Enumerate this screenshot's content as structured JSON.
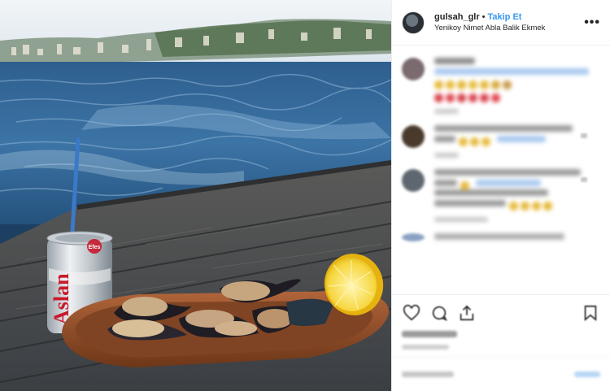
{
  "post": {
    "username": "gulsah_glr",
    "separator": "•",
    "follow_label": "Takip Et",
    "location": "Yenikoy Nimet Abla Balik Ekmek",
    "more_label": "•••"
  },
  "photo": {
    "can_brand": "Aslan",
    "can_badge": "Efes"
  },
  "colors": {
    "link_blue": "#3897f0",
    "border": "#efefef"
  },
  "icons": {
    "like": "heart-icon",
    "comment": "comment-icon",
    "share": "share-icon",
    "save": "bookmark-icon",
    "options": "more-options-icon"
  }
}
